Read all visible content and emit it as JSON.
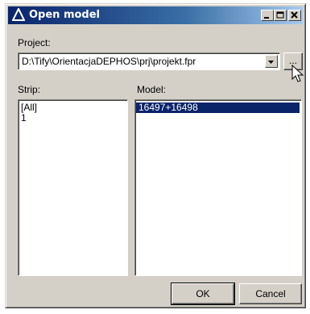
{
  "window": {
    "title": "Open model",
    "controls": {
      "minimize_icon": "minimize-icon",
      "maximize_icon": "maximize-icon",
      "close_icon": "close-icon"
    }
  },
  "project": {
    "label": "Project:",
    "value": "D:\\Tify\\OrientacjaDEPHOS\\prj\\projekt.fpr",
    "browse_label": "..."
  },
  "strip": {
    "label": "Strip:",
    "items": [
      "[All]",
      "1"
    ]
  },
  "model": {
    "label": "Model:",
    "items": [
      "16497+16498"
    ],
    "selected_index": 0
  },
  "buttons": {
    "ok": "OK",
    "cancel": "Cancel"
  },
  "colors": {
    "title_gradient_start": "#0a246a",
    "title_gradient_end": "#a6caf0",
    "face": "#d4d0c8",
    "selection": "#0a246a"
  }
}
